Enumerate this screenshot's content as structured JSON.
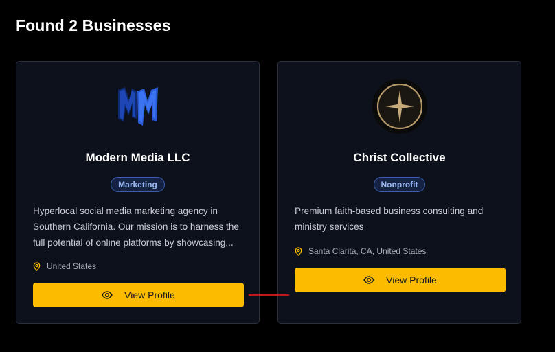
{
  "page": {
    "heading": "Found 2 Businesses"
  },
  "businesses": [
    {
      "name": "Modern Media LLC",
      "logo_icon": "mm-logo-icon",
      "category": "Marketing",
      "description": "Hyperlocal social media marketing agency in Southern California. Our mission is to harness the full potential of online platforms by showcasing...",
      "location": "United States",
      "button_label": "View Profile"
    },
    {
      "name": "Christ Collective",
      "logo_icon": "star-emblem-icon",
      "category": "Nonprofit",
      "description": "Premium faith-based business consulting and ministry services",
      "location": "Santa Clarita, CA, United States",
      "button_label": "View Profile"
    }
  ],
  "colors": {
    "background": "#000000",
    "card": "#0c111b",
    "accent": "#fdbb00",
    "badge_text": "#9ab8f2",
    "location_pin": "#fdbb00"
  }
}
